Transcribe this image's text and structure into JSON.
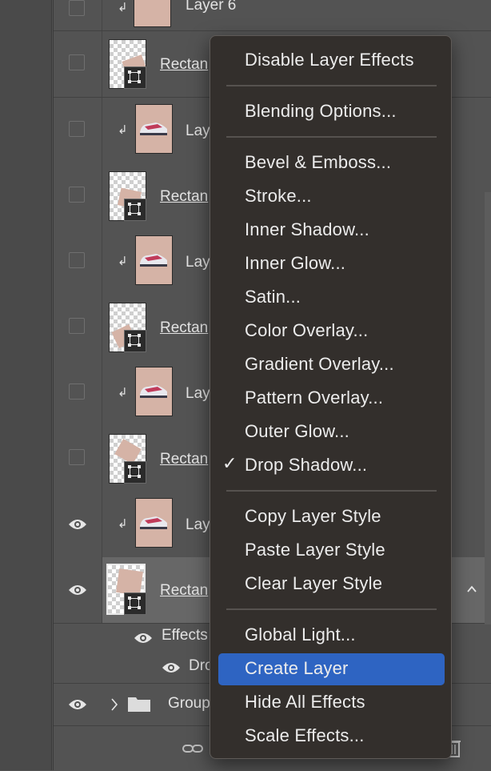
{
  "layers_panel": {
    "rows": [
      {
        "name": "Layer 6",
        "kind": "clipped-image",
        "visible": false
      },
      {
        "name": "Rectan",
        "kind": "shape",
        "visible": false
      },
      {
        "name": "Lay",
        "kind": "clipped-image",
        "visible": false
      },
      {
        "name": "Rectan",
        "kind": "shape",
        "visible": false
      },
      {
        "name": "Lay",
        "kind": "clipped-image",
        "visible": false
      },
      {
        "name": "Rectan",
        "kind": "shape",
        "visible": false
      },
      {
        "name": "Lay",
        "kind": "clipped-image",
        "visible": false
      },
      {
        "name": "Rectan",
        "kind": "shape",
        "visible": false
      },
      {
        "name": "Lay",
        "kind": "clipped-image",
        "visible": true
      },
      {
        "name": "Rectan",
        "kind": "shape",
        "visible": true,
        "selected": true
      }
    ],
    "effects_label": "Effects",
    "effect_item_label": "Dro",
    "group_label": "Group",
    "clip_glyph": "↲",
    "colors": {
      "panel_bg": "#535353",
      "selected_row": "#676767",
      "thumb_pink": "#d5b3a6"
    }
  },
  "context_menu": {
    "items": [
      {
        "label": "Disable Layer Effects"
      },
      {
        "sep": true
      },
      {
        "label": "Blending Options..."
      },
      {
        "sep": true
      },
      {
        "label": "Bevel & Emboss..."
      },
      {
        "label": "Stroke..."
      },
      {
        "label": "Inner Shadow..."
      },
      {
        "label": "Inner Glow..."
      },
      {
        "label": "Satin..."
      },
      {
        "label": "Color Overlay..."
      },
      {
        "label": "Gradient Overlay..."
      },
      {
        "label": "Pattern Overlay..."
      },
      {
        "label": "Outer Glow..."
      },
      {
        "label": "Drop Shadow...",
        "checked": true
      },
      {
        "sep": true
      },
      {
        "label": "Copy Layer Style"
      },
      {
        "label": "Paste Layer Style"
      },
      {
        "label": "Clear Layer Style"
      },
      {
        "sep": true
      },
      {
        "label": "Global Light..."
      },
      {
        "label": "Create Layer",
        "highlighted": true
      },
      {
        "label": "Hide All Effects"
      },
      {
        "label": "Scale Effects..."
      }
    ],
    "check_glyph": "✓",
    "colors": {
      "bg": "#332f2c",
      "highlight": "#2e64c2",
      "text": "#ececec"
    }
  }
}
